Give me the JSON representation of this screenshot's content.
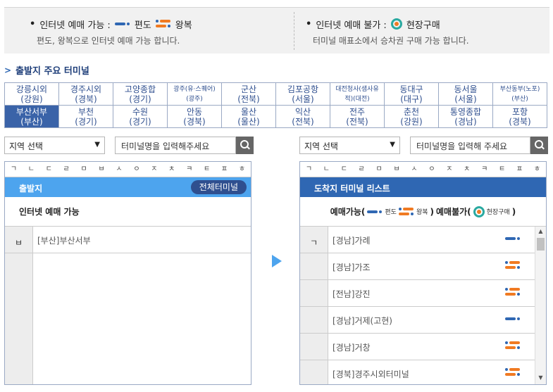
{
  "notice": {
    "left": {
      "bullet": "•",
      "title": "인터넷 예매 가능 :",
      "oneway": "편도",
      "roundtrip": "왕복",
      "desc": "편도, 왕복으로 인터넷 예매 가능 합니다."
    },
    "right": {
      "bullet": "•",
      "title": "인터넷 예매 불가 :",
      "onsite": "현장구매",
      "desc": "터미널 매표소에서 승차권 구매 가능 합니다."
    }
  },
  "major_title": "출발지 주요 터미널",
  "major_terminals": [
    [
      {
        "name": "강릉시외",
        "region": "(강원)"
      },
      {
        "name": "경주시외",
        "region": "(경북)"
      },
      {
        "name": "고양종합",
        "region": "(경기)"
      },
      {
        "name": "광주(유·스퀘어)",
        "region": "(광주)",
        "small": true
      },
      {
        "name": "군산",
        "region": "(전북)"
      },
      {
        "name": "김포공항",
        "region": "(서울)"
      },
      {
        "name": "대전청사(샘사유",
        "region": "적)(대전)",
        "small": true
      },
      {
        "name": "동대구",
        "region": "(대구)"
      },
      {
        "name": "동서울",
        "region": "(서울)"
      },
      {
        "name": "부산동부(노포)",
        "region": "(부산)",
        "small": true
      }
    ],
    [
      {
        "name": "부산서부",
        "region": "(부산)",
        "active": true
      },
      {
        "name": "부천",
        "region": "(경기)"
      },
      {
        "name": "수원",
        "region": "(경기)"
      },
      {
        "name": "안동",
        "region": "(경북)"
      },
      {
        "name": "울산",
        "region": "(울산)"
      },
      {
        "name": "익산",
        "region": "(전북)"
      },
      {
        "name": "전주",
        "region": "(전북)"
      },
      {
        "name": "춘천",
        "region": "(강원)"
      },
      {
        "name": "통영종합",
        "region": "(경남)"
      },
      {
        "name": "포항",
        "region": "(경북)"
      }
    ]
  ],
  "left_search": {
    "region_select": "지역 선택",
    "terminal_input": "터미널명을 입력해주세요"
  },
  "right_search": {
    "region_select": "지역 선택",
    "terminal_input": "터미널명을 입력해 주세요"
  },
  "consonants": [
    "ㄱ",
    "ㄴ",
    "ㄷ",
    "ㄹ",
    "ㅁ",
    "ㅂ",
    "ㅅ",
    "ㅇ",
    "ㅈ",
    "ㅊ",
    "ㅋ",
    "ㅌ",
    "ㅍ",
    "ㅎ"
  ],
  "departure": {
    "header": "출발지",
    "all_button": "전체터미널",
    "subheader": "인터넷 예매 가능",
    "index": "ㅂ",
    "items": [
      {
        "region": "[부산]",
        "name": "부산서부"
      }
    ]
  },
  "arrival": {
    "header": "도착지 터미널 리스트",
    "legend": {
      "avail": "예매가능(",
      "oneway": "편도",
      "round": "왕복",
      "close1": ")",
      "unavail": "예매불가(",
      "onsite": "현장구매",
      "close2": ")"
    },
    "index": "ㄱ",
    "items": [
      {
        "region": "[경남]",
        "name": "가례",
        "type": "oneway"
      },
      {
        "region": "[경남]",
        "name": "가조",
        "type": "roundtrip"
      },
      {
        "region": "[전남]",
        "name": "강진",
        "type": "roundtrip"
      },
      {
        "region": "[경남]",
        "name": "거제(고현)",
        "type": "oneway"
      },
      {
        "region": "[경남]",
        "name": "거창",
        "type": "roundtrip"
      },
      {
        "region": "[경북]",
        "name": "경주시외터미널",
        "type": "roundtrip"
      }
    ]
  },
  "colors": {
    "accent": "#2f67b3",
    "light_accent": "#4da4ee",
    "orange": "#f07a22",
    "teal": "#2aa9a0"
  }
}
